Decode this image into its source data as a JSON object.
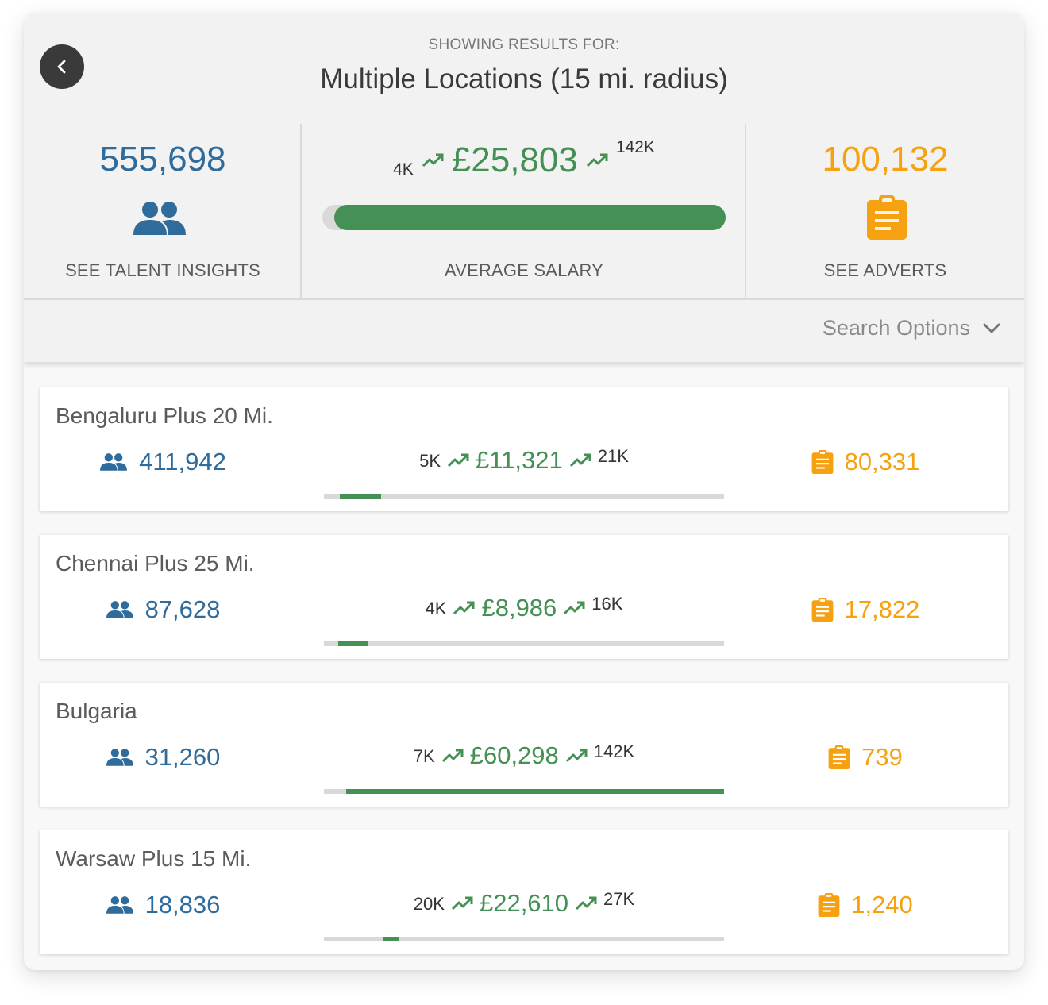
{
  "header": {
    "subtitle": "SHOWING RESULTS FOR:",
    "title": "Multiple Locations (15 mi. radius)",
    "back_icon": "chevron-left-icon"
  },
  "summary": {
    "talent": {
      "value": "555,698",
      "label": "SEE TALENT INSIGHTS",
      "icon": "people-icon",
      "color": "#2f6b9b"
    },
    "salary": {
      "min": "4K",
      "value": "£25,803",
      "max": "142K",
      "label": "AVERAGE SALARY",
      "icon": "trending-up-icon",
      "color": "#459054",
      "range": [
        0.03,
        1.0
      ]
    },
    "adverts": {
      "value": "100,132",
      "label": "SEE ADVERTS",
      "icon": "clipboard-icon",
      "color": "#f5a110"
    }
  },
  "search_options": {
    "label": "Search Options",
    "icon": "chevron-down-icon"
  },
  "locations": [
    {
      "name": "Bengaluru Plus 20 Mi.",
      "talent": "411,942",
      "salary_min": "5K",
      "salary": "£11,321",
      "salary_max": "21K",
      "adverts": "80,331",
      "range": [
        0.04,
        0.143
      ]
    },
    {
      "name": "Chennai Plus 25 Mi.",
      "talent": "87,628",
      "salary_min": "4K",
      "salary": "£8,986",
      "salary_max": "16K",
      "adverts": "17,822",
      "range": [
        0.036,
        0.111
      ]
    },
    {
      "name": "Bulgaria",
      "talent": "31,260",
      "salary_min": "7K",
      "salary": "£60,298",
      "salary_max": "142K",
      "adverts": "739",
      "range": [
        0.056,
        1.0
      ]
    },
    {
      "name": "Warsaw Plus 15 Mi.",
      "talent": "18,836",
      "salary_min": "20K",
      "salary": "£22,610",
      "salary_max": "27K",
      "adverts": "1,240",
      "range": [
        0.147,
        0.187
      ]
    }
  ]
}
